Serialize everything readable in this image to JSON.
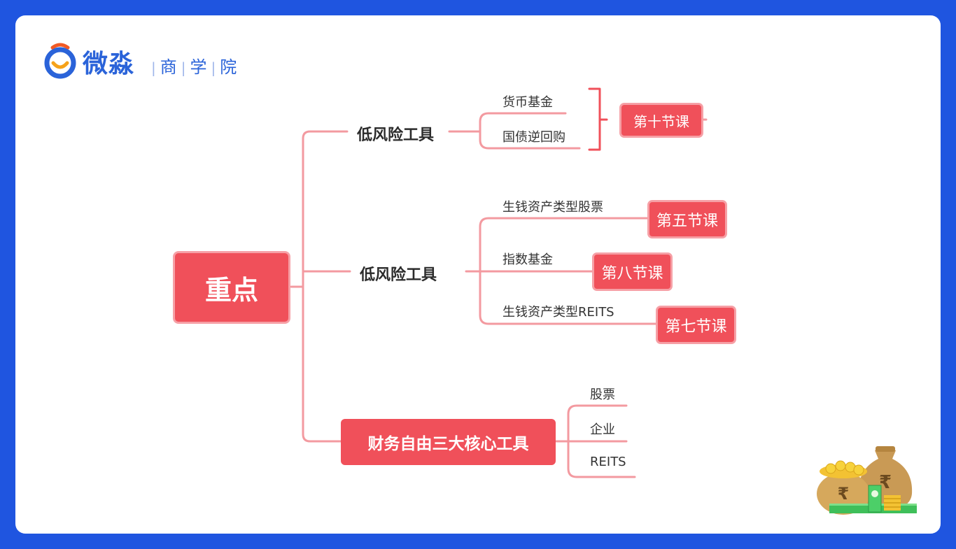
{
  "logo": {
    "brand": "微淼",
    "sub": [
      "商",
      "学",
      "院"
    ]
  },
  "root": {
    "label": "重点"
  },
  "branches": [
    {
      "label": "低风险工具",
      "leaves": [
        "货币基金",
        "国债逆回购"
      ],
      "tag": "第十节课"
    },
    {
      "label": "低风险工具",
      "leaves": [
        {
          "label": "生钱资产类型股票",
          "tag": "第五节课"
        },
        {
          "label": "指数基金",
          "tag": "第八节课"
        },
        {
          "label": "生钱资产类型REITS",
          "tag": "第七节课"
        }
      ]
    },
    {
      "label": "财务自由三大核心工具",
      "leaves": [
        "股票",
        "企业",
        "REITS"
      ]
    }
  ],
  "colors": {
    "accent": "#f0505a",
    "line": "#f39aa0",
    "brand": "#2a63d9",
    "background": "#1f55e0"
  }
}
